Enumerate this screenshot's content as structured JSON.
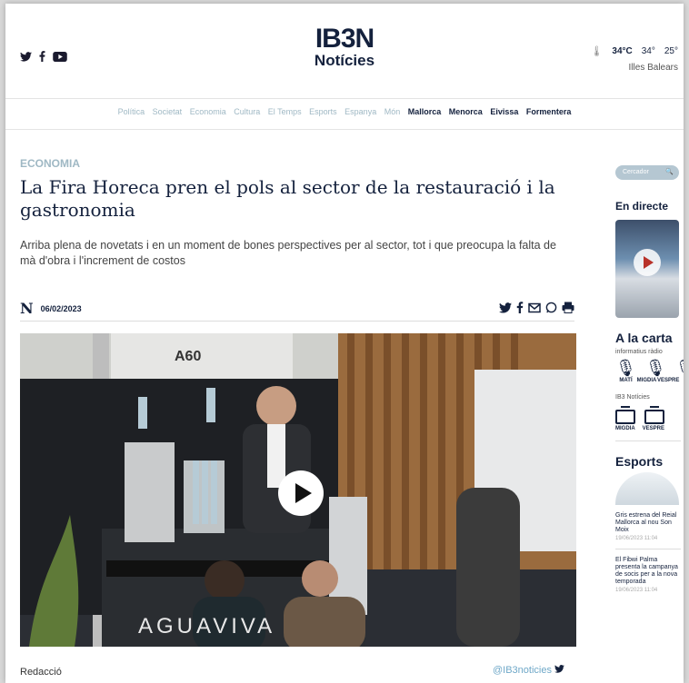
{
  "header": {
    "social_icons": [
      "twitter-icon",
      "facebook-icon",
      "youtube-icon"
    ],
    "logo_line1": "IB3N",
    "logo_line2": "Notícies",
    "weather": {
      "temp": "34°C",
      "max": "34°",
      "min": "25°",
      "region": "Illes Balears"
    }
  },
  "nav": {
    "light_items": [
      "Política",
      "Societat",
      "Economia",
      "Cultura",
      "El Temps",
      "Esports",
      "Espanya",
      "Món"
    ],
    "dark_items": [
      "Mallorca",
      "Menorca",
      "Eivissa",
      "Formentera"
    ]
  },
  "article": {
    "section": "ECONOMIA",
    "title": "La Fira Horeca pren el pols al sector de la restauració i la gastronomia",
    "lead": "Arriba plena de novetats i en un moment de bones perspectives per al sector, tot i que preocupa la falta de mà d'obra i l'increment de costos",
    "logo_n": "N",
    "date": "06/02/2023",
    "video_sign_text": "A60",
    "byline": "Redacció",
    "twitter_handle": "@IB3noticies"
  },
  "sidebar": {
    "search_placeholder": "Cercador",
    "live_heading": "En directe",
    "ondemand_heading": "A la carta",
    "radio_label": "informatius ràdio",
    "radio_items": [
      "MATÍ",
      "MIGDIA",
      "VESPRE"
    ],
    "tv_label": "IB3 Notícies",
    "tv_items": [
      "MIGDIA",
      "VESPRE"
    ],
    "sports_heading": "Esports",
    "news": [
      {
        "text": "Gris estrena del Reial Mallorca al nou Son Moix",
        "time": "19/06/2023 11:04"
      },
      {
        "text": "El Fibwi Palma presenta la campanya de socis per a la nova temporada",
        "time": "19/06/2023 11:04"
      }
    ]
  }
}
